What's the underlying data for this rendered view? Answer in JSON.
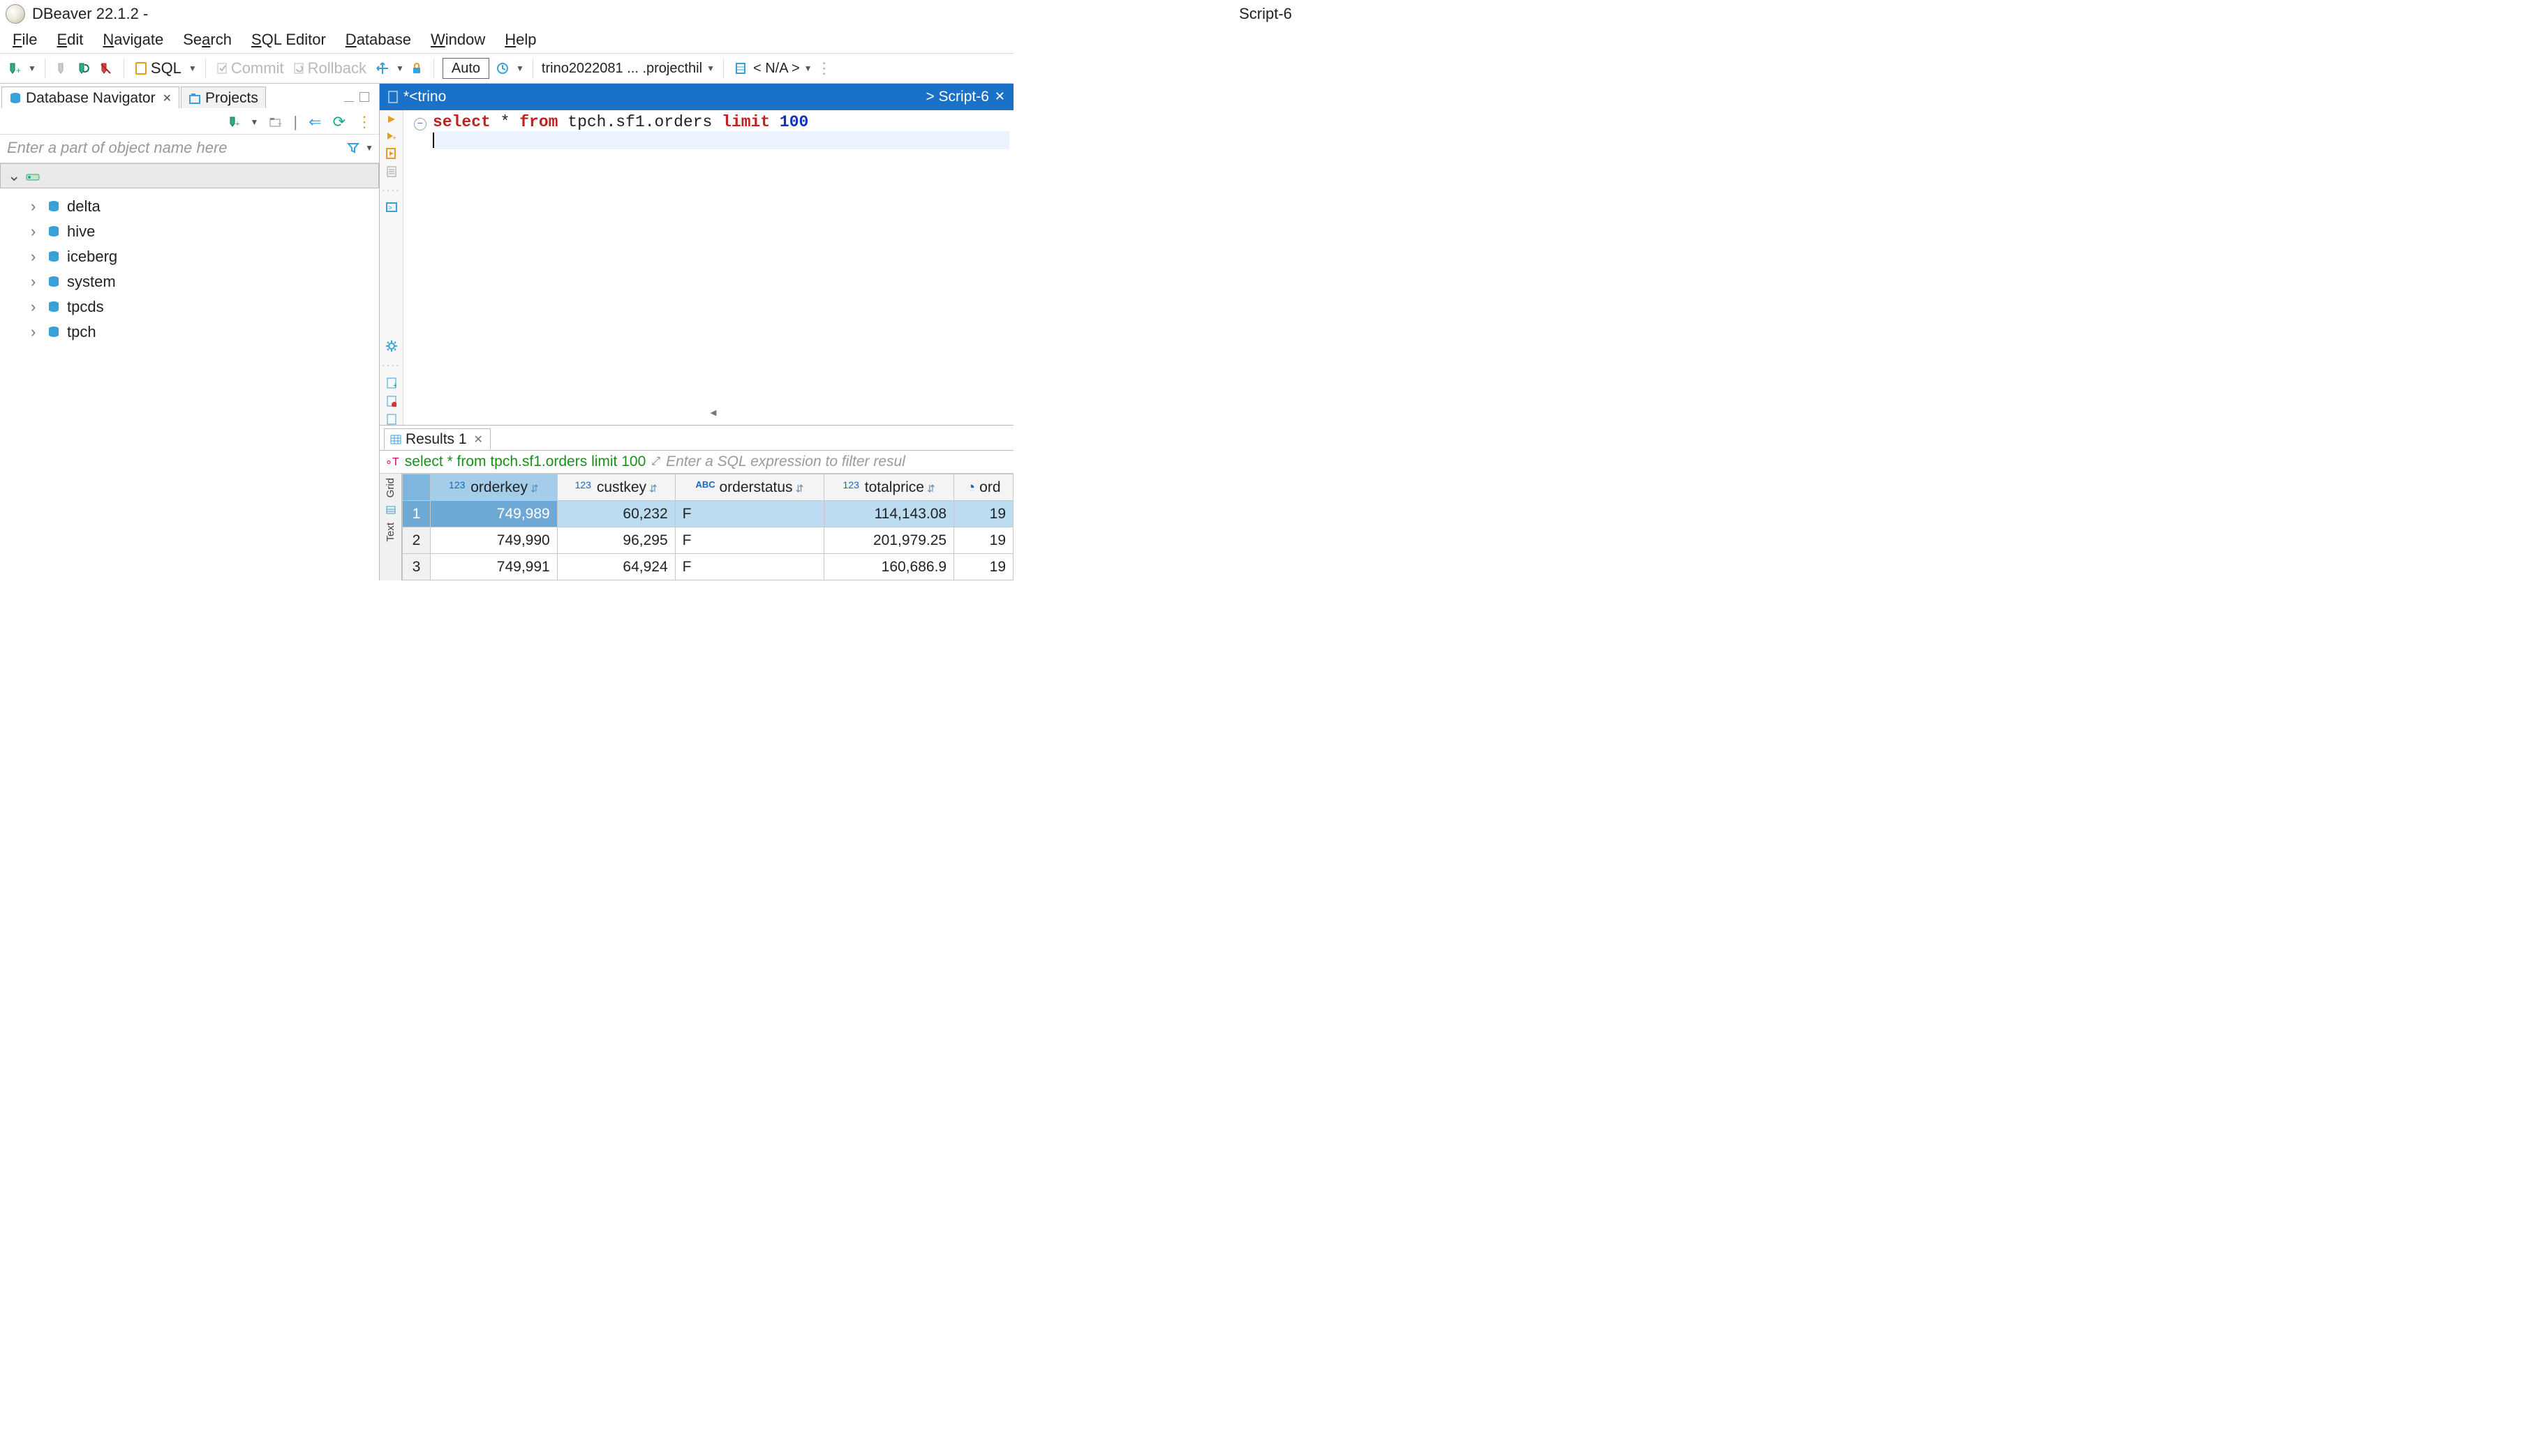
{
  "title": {
    "app": "DBeaver 22.1.2 -",
    "center": "Script-6"
  },
  "menu": {
    "file": "File",
    "edit": "Edit",
    "navigate": "Navigate",
    "search": "Search",
    "sqlEditor": "SQL Editor",
    "database": "Database",
    "window": "Window",
    "help": "Help"
  },
  "toolbar": {
    "sql_label": "SQL",
    "commit": "Commit",
    "rollback": "Rollback",
    "auto": "Auto",
    "conn": "trino2022081 ... .projecthil",
    "db_na": "< N/A >"
  },
  "leftPane": {
    "tab_nav": "Database Navigator",
    "tab_projects": "Projects",
    "filter_placeholder": "Enter a part of object name here",
    "databases": [
      "delta",
      "hive",
      "iceberg",
      "system",
      "tpcds",
      "tpch"
    ]
  },
  "editor": {
    "tab_left": "*<trino",
    "tab_right": "> Script-6",
    "code_select": "select",
    "code_star": " * ",
    "code_from": "from",
    "code_table": " tpch.sf1.orders ",
    "code_limit": "limit",
    "code_num": " 100"
  },
  "results": {
    "tab": "Results 1",
    "query": "select * from tpch.sf1.orders limit 100",
    "filter_hint": "Enter a SQL expression to filter resul",
    "side_grid": "Grid",
    "side_text": "Text",
    "columns": [
      "orderkey",
      "custkey",
      "orderstatus",
      "totalprice",
      "ord"
    ],
    "rows": [
      {
        "n": "1",
        "orderkey": "749,989",
        "custkey": "60,232",
        "orderstatus": "F",
        "totalprice": "114,143.08",
        "ord": "19"
      },
      {
        "n": "2",
        "orderkey": "749,990",
        "custkey": "96,295",
        "orderstatus": "F",
        "totalprice": "201,979.25",
        "ord": "19"
      },
      {
        "n": "3",
        "orderkey": "749,991",
        "custkey": "64,924",
        "orderstatus": "F",
        "totalprice": "160,686.9",
        "ord": "19"
      }
    ]
  }
}
